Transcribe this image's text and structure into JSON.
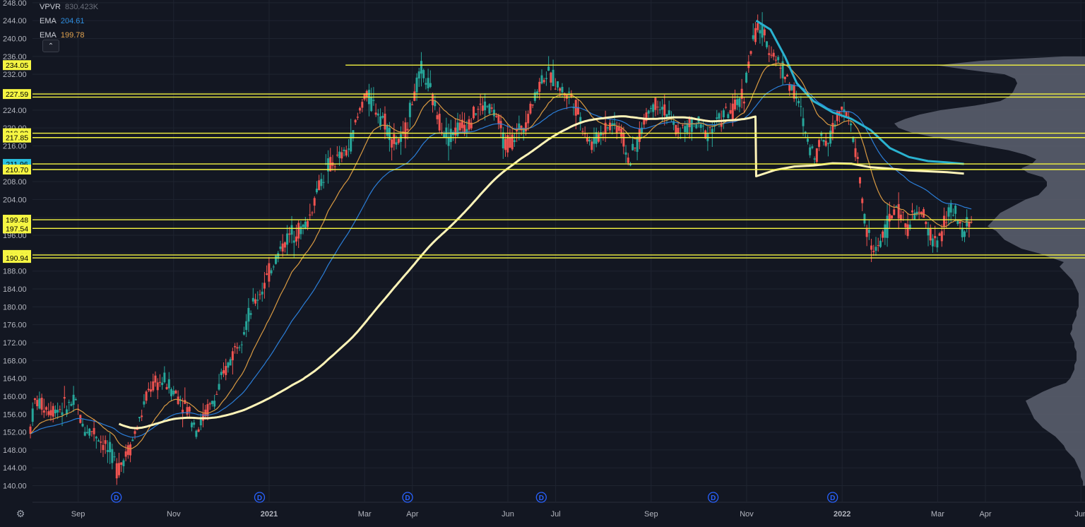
{
  "legend": {
    "vpvr": {
      "name": "VPVR",
      "value": "830.423K"
    },
    "ema_fast": {
      "name": "EMA",
      "value": "204.61"
    },
    "ema_slow": {
      "name": "EMA",
      "value": "199.78"
    },
    "collapse_icon": "chevron-up-icon"
  },
  "settings_icon": "gear-icon",
  "colors": {
    "background": "#131722",
    "grid": "#1f2430",
    "axis_text": "#b2b5be",
    "up_candle": "#26a69a",
    "down_candle": "#ef5350",
    "level_line": "#f5f542",
    "level_tag_bg": "#f5f542",
    "level_tag_text": "#000000",
    "ema_blue_tag_bg": "#2ac0de",
    "ma_200": "#fff4b8",
    "ema_thick_blue": "#2ab2d0",
    "ema_fast_orange": "#d99a42",
    "ema_slow_blue": "#2b7ed8",
    "volume_profile": "#5d6270",
    "dividend_marker": "#2962ff"
  },
  "chart_data": {
    "type": "candlestick",
    "ylim": [
      138,
      249
    ],
    "y_ticks": [
      "248.00",
      "244.00",
      "240.00",
      "236.00",
      "232.00",
      "228.00",
      "224.00",
      "220.00",
      "216.00",
      "212.00",
      "208.00",
      "204.00",
      "200.00",
      "196.00",
      "192.00",
      "188.00",
      "184.00",
      "180.00",
      "176.00",
      "172.00",
      "168.00",
      "164.00",
      "160.00",
      "156.00",
      "152.00",
      "148.00",
      "144.00",
      "140.00"
    ],
    "x_labels": [
      "Sep",
      "Nov",
      "2021",
      "Mar",
      "Apr",
      "Jun",
      "Jul",
      "Sep",
      "Nov",
      "2022",
      "Mar",
      "Apr",
      "Jun"
    ],
    "x_label_months": [
      1,
      3,
      5,
      7,
      8,
      10,
      11,
      13,
      15,
      17,
      19,
      20,
      22
    ],
    "dividend_markers": {
      "label": "D",
      "months": [
        1.8,
        4.8,
        7.9,
        10.7,
        14.3,
        16.8
      ]
    },
    "levels": [
      {
        "value": 234.05,
        "label": "234.05",
        "start_month": 6.6
      },
      {
        "value": 227.59,
        "label": "227.59",
        "start_month": 0
      },
      {
        "value": 226.9,
        "label": "",
        "start_month": 0
      },
      {
        "value": 218.83,
        "label": "218.83",
        "start_month": 0
      },
      {
        "value": 217.85,
        "label": "217.85",
        "start_month": 0
      },
      {
        "value": 211.96,
        "label": "211.96",
        "start_month": 0,
        "tag": "blue"
      },
      {
        "value": 210.7,
        "label": "210.70",
        "start_month": 0
      },
      {
        "value": 199.48,
        "label": "199.48",
        "start_month": 0
      },
      {
        "value": 197.54,
        "label": "197.54",
        "start_month": 0
      },
      {
        "value": 191.6,
        "label": "191.60",
        "start_month": 0
      },
      {
        "value": 190.94,
        "label": "190.94",
        "start_month": 0
      }
    ],
    "price_path": [
      [
        0,
        153
      ],
      [
        0.1,
        159
      ],
      [
        0.4,
        157
      ],
      [
        0.7,
        157.5
      ],
      [
        0.95,
        158.5
      ],
      [
        1.1,
        153
      ],
      [
        1.35,
        152
      ],
      [
        1.55,
        149
      ],
      [
        1.75,
        146
      ],
      [
        1.82,
        143.5
      ],
      [
        2.1,
        149
      ],
      [
        2.3,
        155
      ],
      [
        2.5,
        162
      ],
      [
        2.8,
        163.5
      ],
      [
        3.1,
        160
      ],
      [
        3.3,
        157
      ],
      [
        3.5,
        152.5
      ],
      [
        3.65,
        156
      ],
      [
        3.85,
        159
      ],
      [
        4.1,
        166
      ],
      [
        4.3,
        171
      ],
      [
        4.5,
        176
      ],
      [
        4.7,
        181
      ],
      [
        4.9,
        185
      ],
      [
        5.1,
        190
      ],
      [
        5.3,
        194
      ],
      [
        5.5,
        197
      ],
      [
        5.65,
        197
      ],
      [
        5.82,
        199
      ],
      [
        6.0,
        206
      ],
      [
        6.2,
        211
      ],
      [
        6.45,
        213
      ],
      [
        6.65,
        215
      ],
      [
        6.85,
        222
      ],
      [
        7.0,
        227.5
      ],
      [
        7.2,
        225
      ],
      [
        7.4,
        222
      ],
      [
        7.6,
        217
      ],
      [
        7.8,
        217
      ],
      [
        8.0,
        226
      ],
      [
        8.2,
        233
      ],
      [
        8.35,
        229
      ],
      [
        8.55,
        222
      ],
      [
        8.75,
        218
      ],
      [
        8.95,
        220
      ],
      [
        9.15,
        221
      ],
      [
        9.35,
        224
      ],
      [
        9.55,
        225
      ],
      [
        9.75,
        223
      ],
      [
        9.95,
        216
      ],
      [
        10.15,
        218
      ],
      [
        10.4,
        222
      ],
      [
        10.6,
        228
      ],
      [
        10.75,
        232
      ],
      [
        10.95,
        231
      ],
      [
        11.15,
        228
      ],
      [
        11.35,
        227
      ],
      [
        11.55,
        221
      ],
      [
        11.75,
        216
      ],
      [
        11.95,
        219
      ],
      [
        12.15,
        221
      ],
      [
        12.35,
        220
      ],
      [
        12.55,
        212
      ],
      [
        12.75,
        218
      ],
      [
        12.95,
        224
      ],
      [
        13.15,
        226
      ],
      [
        13.35,
        223
      ],
      [
        13.55,
        219
      ],
      [
        13.75,
        220
      ],
      [
        13.95,
        221
      ],
      [
        14.15,
        219
      ],
      [
        14.35,
        221
      ],
      [
        14.55,
        223
      ],
      [
        14.75,
        224
      ],
      [
        14.95,
        228
      ],
      [
        15.1,
        238
      ],
      [
        15.25,
        243
      ],
      [
        15.4,
        239
      ],
      [
        15.55,
        237
      ],
      [
        15.75,
        233
      ],
      [
        15.95,
        229
      ],
      [
        16.1,
        225
      ],
      [
        16.3,
        216
      ],
      [
        16.45,
        214
      ],
      [
        16.55,
        218
      ],
      [
        16.7,
        217
      ],
      [
        16.85,
        221
      ],
      [
        17.0,
        226
      ],
      [
        17.15,
        221
      ],
      [
        17.25,
        217
      ],
      [
        17.35,
        211
      ],
      [
        17.45,
        200
      ],
      [
        17.55,
        196
      ],
      [
        17.65,
        192
      ],
      [
        17.8,
        195
      ],
      [
        17.95,
        198
      ],
      [
        18.1,
        202
      ],
      [
        18.25,
        200
      ],
      [
        18.4,
        198
      ],
      [
        18.55,
        201
      ],
      [
        18.7,
        200
      ],
      [
        18.85,
        196
      ],
      [
        19.0,
        194
      ],
      [
        19.15,
        199
      ],
      [
        19.3,
        202
      ],
      [
        19.45,
        198
      ],
      [
        19.55,
        196
      ],
      [
        19.65,
        200
      ],
      [
        19.72,
        197.5
      ]
    ],
    "ema_thick_blue_path": [
      [
        15.2,
        244
      ],
      [
        15.5,
        242
      ],
      [
        15.8,
        236
      ],
      [
        16.05,
        230
      ],
      [
        16.4,
        226
      ],
      [
        16.8,
        223.5
      ],
      [
        17.2,
        222
      ],
      [
        17.6,
        219.5
      ],
      [
        18.0,
        215.5
      ],
      [
        18.4,
        213.5
      ],
      [
        18.8,
        212.6
      ],
      [
        19.2,
        212.3
      ],
      [
        19.55,
        211.96
      ]
    ],
    "ma_200_end_path": [
      [
        15.2,
        209.2
      ],
      [
        15.6,
        210.6
      ],
      [
        16.0,
        211.4
      ],
      [
        16.4,
        211.6
      ],
      [
        16.8,
        212.1
      ],
      [
        17.2,
        212.0
      ],
      [
        17.6,
        211.2
      ],
      [
        18.0,
        210.9
      ],
      [
        18.4,
        210.5
      ],
      [
        18.8,
        210.3
      ],
      [
        19.2,
        210.1
      ],
      [
        19.55,
        209.8
      ]
    ],
    "volume_profile_bins": [
      [
        236,
        0.1
      ],
      [
        235,
        0.5
      ],
      [
        234,
        0.7
      ],
      [
        233,
        0.55
      ],
      [
        232,
        0.38
      ],
      [
        231,
        0.33
      ],
      [
        230,
        0.32
      ],
      [
        229,
        0.33
      ],
      [
        228,
        0.34
      ],
      [
        227,
        0.36
      ],
      [
        226,
        0.4
      ],
      [
        225,
        0.52
      ],
      [
        224,
        0.68
      ],
      [
        223,
        0.78
      ],
      [
        222,
        0.85
      ],
      [
        221,
        0.9
      ],
      [
        220,
        0.88
      ],
      [
        219,
        0.82
      ],
      [
        218,
        0.72
      ],
      [
        217,
        0.6
      ],
      [
        216,
        0.48
      ],
      [
        215,
        0.36
      ],
      [
        214,
        0.28
      ],
      [
        213,
        0.23
      ],
      [
        212,
        0.25
      ],
      [
        211,
        0.3
      ],
      [
        210,
        0.27
      ],
      [
        209,
        0.2
      ],
      [
        208,
        0.18
      ],
      [
        207,
        0.18
      ],
      [
        206,
        0.2
      ],
      [
        205,
        0.22
      ],
      [
        204,
        0.28
      ],
      [
        203,
        0.32
      ],
      [
        202,
        0.36
      ],
      [
        201,
        0.4
      ],
      [
        200,
        0.42
      ],
      [
        199,
        0.44
      ],
      [
        198,
        0.46
      ],
      [
        197,
        0.42
      ],
      [
        196,
        0.4
      ],
      [
        195,
        0.38
      ],
      [
        194,
        0.34
      ],
      [
        193,
        0.3
      ],
      [
        192,
        0.22
      ],
      [
        191,
        0.16
      ],
      [
        190,
        0.1
      ],
      [
        189,
        0.12
      ],
      [
        188,
        0.1
      ],
      [
        187,
        0.08
      ],
      [
        186,
        0.06
      ],
      [
        185,
        0.05
      ],
      [
        184,
        0.04
      ],
      [
        183,
        0.03
      ],
      [
        182,
        0.03
      ],
      [
        181,
        0.03
      ],
      [
        180,
        0.03
      ],
      [
        179,
        0.04
      ],
      [
        178,
        0.04
      ],
      [
        177,
        0.05
      ],
      [
        176,
        0.06
      ],
      [
        175,
        0.06
      ],
      [
        174,
        0.07
      ],
      [
        173,
        0.06
      ],
      [
        172,
        0.05
      ],
      [
        171,
        0.05
      ],
      [
        170,
        0.04
      ],
      [
        169,
        0.04
      ],
      [
        168,
        0.04
      ],
      [
        167,
        0.05
      ],
      [
        166,
        0.05
      ],
      [
        165,
        0.06
      ],
      [
        164,
        0.07
      ],
      [
        163,
        0.09
      ],
      [
        162,
        0.15
      ],
      [
        161,
        0.2
      ],
      [
        160,
        0.24
      ],
      [
        159,
        0.28
      ],
      [
        158,
        0.27
      ],
      [
        157,
        0.26
      ],
      [
        156,
        0.25
      ],
      [
        155,
        0.24
      ],
      [
        154,
        0.22
      ],
      [
        153,
        0.2
      ],
      [
        152,
        0.17
      ],
      [
        151,
        0.14
      ],
      [
        150,
        0.12
      ],
      [
        149,
        0.1
      ],
      [
        148,
        0.09
      ],
      [
        147,
        0.07
      ],
      [
        146,
        0.05
      ],
      [
        145,
        0.04
      ],
      [
        144,
        0.03
      ],
      [
        143,
        0.02
      ],
      [
        142,
        0.02
      ],
      [
        141,
        0.01
      ],
      [
        140,
        0.01
      ]
    ]
  }
}
